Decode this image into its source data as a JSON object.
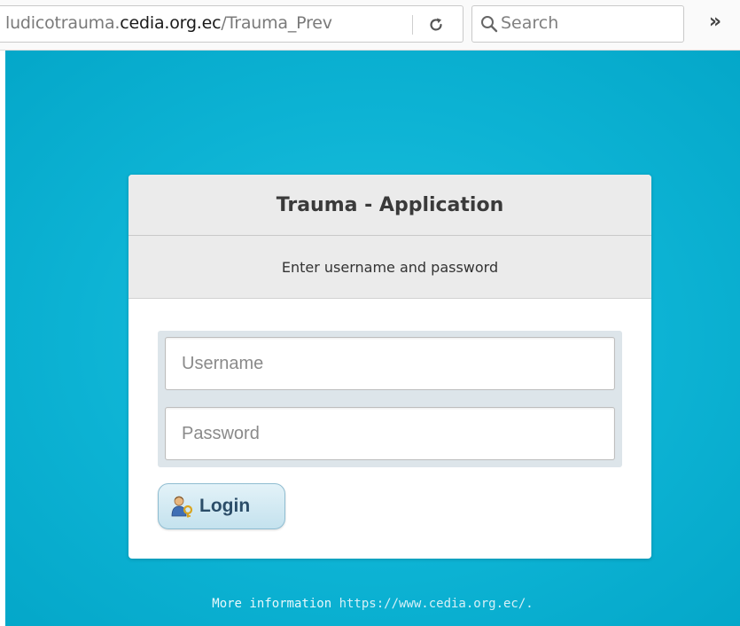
{
  "browser": {
    "url_prefix": "ludicotrauma.",
    "url_domain": "cedia.org.ec",
    "url_path": "/Trauma_Prev",
    "search_placeholder": "Search",
    "overflow_glyph": "»"
  },
  "login": {
    "title": "Trauma - Application",
    "subtitle": "Enter username and password",
    "username_placeholder": "Username",
    "password_placeholder": "Password",
    "login_label": "Login"
  },
  "footer": {
    "text": "More information",
    "link": "https://www.cedia.org.ec/."
  },
  "colors": {
    "page_background": "#0db3d4",
    "button_text": "#2b4d68"
  },
  "icons": {
    "reload": "reload-icon",
    "search": "search-icon",
    "login": "user-key-icon"
  }
}
